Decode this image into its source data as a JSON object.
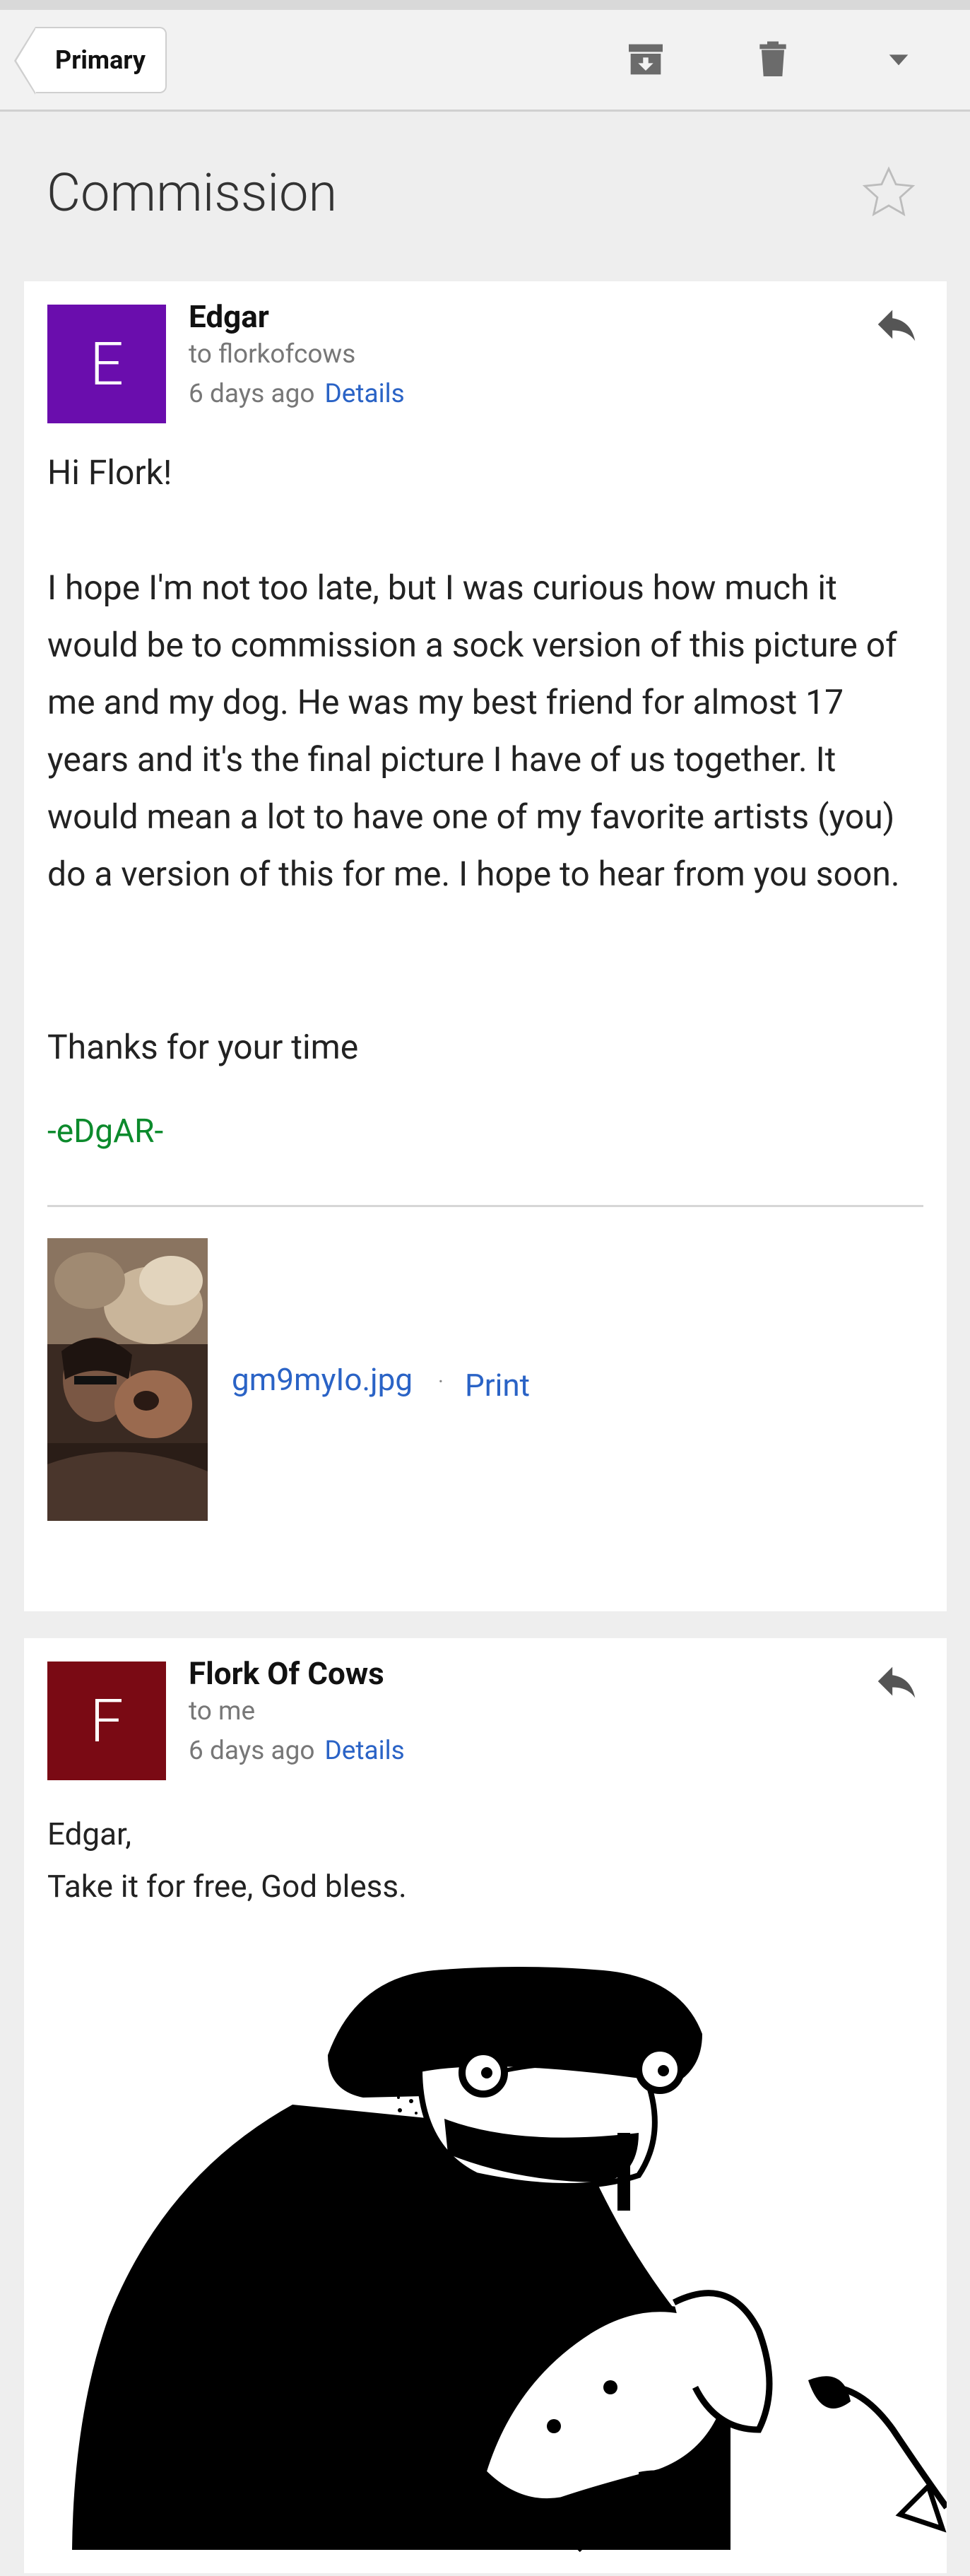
{
  "toolbar": {
    "tab_label": "Primary",
    "icons": [
      "archive-icon",
      "trash-icon",
      "more-dropdown-icon"
    ]
  },
  "thread": {
    "subject": "Commission",
    "star_icon": "star-outline-icon"
  },
  "messages": [
    {
      "avatar_letter": "E",
      "avatar_color": "#6a0dad",
      "sender": "Edgar",
      "to": "to florkofcows",
      "time": "6 days ago",
      "details": "Details",
      "greeting": "Hi Flork!",
      "paragraph": "I hope I'm not too late, but I was curious how much it would be to commission a sock version of this picture of me and my dog. He was my best friend for almost 17 years and it's the final picture I have of us together. It would mean a lot to have one of my favorite artists (you) do a version of this for me. I hope to hear from you soon.",
      "closing": "Thanks for your time",
      "signature": "-eDgAR-",
      "attachment": {
        "filename": "gm9myIo.jpg",
        "separator": "·",
        "print": "Print"
      }
    },
    {
      "avatar_letter": "F",
      "avatar_color": "#7a0a14",
      "sender": "Flork Of Cows",
      "to": "to me",
      "time": "6 days ago",
      "details": "Details",
      "line1": "Edgar,",
      "line2": "Take it for free, God bless."
    }
  ]
}
